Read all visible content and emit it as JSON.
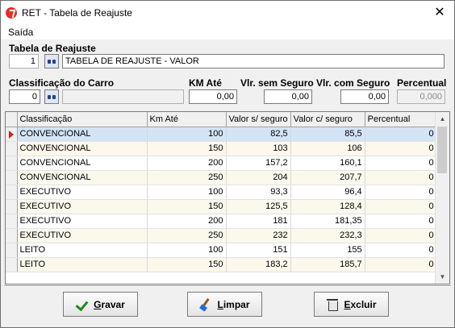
{
  "window": {
    "title": "RET - Tabela de Reajuste",
    "close_glyph": "✕"
  },
  "menu": {
    "items": [
      "Saída"
    ]
  },
  "tabela": {
    "label": "Tabela de Reajuste",
    "code": "1",
    "description": "TABELA DE REAJUSTE - VALOR"
  },
  "form": {
    "classificacao_label": "Classificação do Carro",
    "classificacao_code": "0",
    "classificacao_desc": "",
    "km_label": "KM Até",
    "km_value": "0,00",
    "vlr_sem_label": "Vlr. sem Seguro",
    "vlr_sem_value": "0,00",
    "vlr_com_label": "Vlr. com Seguro",
    "vlr_com_value": "0,00",
    "percentual_label": "Percentual",
    "percentual_value": "0,000"
  },
  "grid": {
    "columns": [
      "Classificação",
      "Km Até",
      "Valor s/ seguro",
      "Valor c/ seguro",
      "Percentual"
    ],
    "rows": [
      [
        "CONVENCIONAL",
        "100",
        "82,5",
        "85,5",
        "0"
      ],
      [
        "CONVENCIONAL",
        "150",
        "103",
        "106",
        "0"
      ],
      [
        "CONVENCIONAL",
        "200",
        "157,2",
        "160,1",
        "0"
      ],
      [
        "CONVENCIONAL",
        "250",
        "204",
        "207,7",
        "0"
      ],
      [
        "EXECUTIVO",
        "100",
        "93,3",
        "96,4",
        "0"
      ],
      [
        "EXECUTIVO",
        "150",
        "125,5",
        "128,4",
        "0"
      ],
      [
        "EXECUTIVO",
        "200",
        "181",
        "181,35",
        "0"
      ],
      [
        "EXECUTIVO",
        "250",
        "232",
        "232,3",
        "0"
      ],
      [
        "LEITO",
        "100",
        "151",
        "155",
        "0"
      ],
      [
        "LEITO",
        "150",
        "183,2",
        "185,7",
        "0"
      ]
    ],
    "selected_row": 0
  },
  "buttons": {
    "gravar_first": "G",
    "gravar_rest": "ravar",
    "limpar_first": "L",
    "limpar_rest": "impar",
    "excluir_first": "E",
    "excluir_rest": "xcluir"
  },
  "colors": {
    "selected_row": "#d4e4f7",
    "alt_row": "#fdf8ec",
    "indicator_arrow": "#d32020"
  }
}
